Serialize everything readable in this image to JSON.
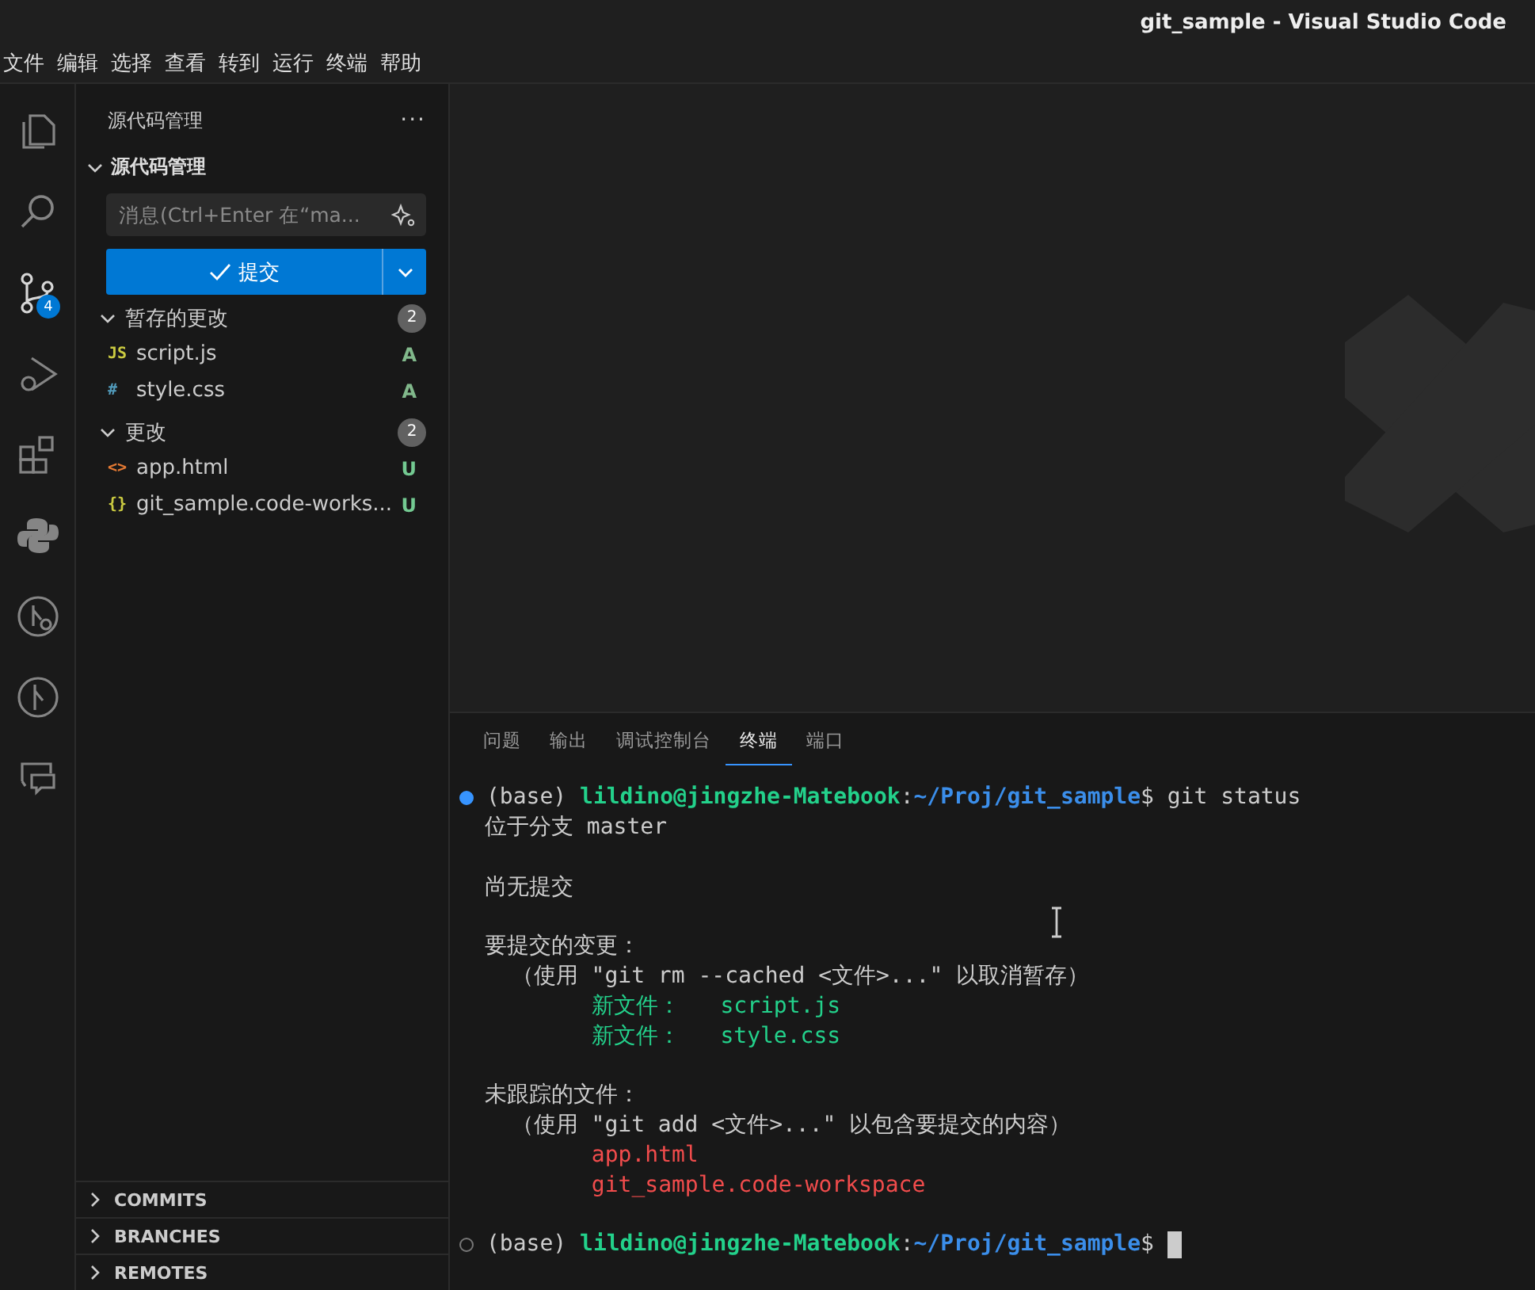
{
  "window": {
    "title": "git_sample - Visual Studio Code"
  },
  "menu": [
    "文件",
    "编辑",
    "选择",
    "查看",
    "转到",
    "运行",
    "终端",
    "帮助"
  ],
  "activity_bar": [
    {
      "kind": "explorer",
      "selected": false
    },
    {
      "kind": "search",
      "selected": false
    },
    {
      "kind": "source_control",
      "selected": true,
      "badge": "4"
    },
    {
      "kind": "run_debug",
      "selected": false
    },
    {
      "kind": "extensions",
      "selected": false
    },
    {
      "kind": "python",
      "selected": false
    },
    {
      "kind": "git_history",
      "selected": false
    },
    {
      "kind": "git_graph",
      "selected": false
    },
    {
      "kind": "remote",
      "selected": false
    }
  ],
  "sidebar": {
    "title": "源代码管理",
    "more": "···",
    "section": {
      "title": "源代码管理",
      "expanded": true
    },
    "message": {
      "placeholder": "消息(Ctrl+Enter 在“ma..."
    },
    "commit_button": {
      "label": "提交"
    },
    "groups": [
      {
        "kind": "staged",
        "title": "暂存的更改",
        "expanded": true,
        "count": "2",
        "files": [
          {
            "icon": "JS",
            "color": "#cbcb41",
            "name": "script.js",
            "status": "A"
          },
          {
            "icon": "#",
            "color": "#519aba",
            "name": "style.css",
            "status": "A"
          }
        ]
      },
      {
        "kind": "changes",
        "title": "更改",
        "expanded": true,
        "count": "2",
        "files": [
          {
            "icon": "<>",
            "color": "#e37933",
            "name": "app.html",
            "status": "U"
          },
          {
            "icon": "{}",
            "color": "#cbcb41",
            "name": "git_sample.code-works...",
            "status": "U"
          }
        ]
      }
    ],
    "bottom_sections": [
      {
        "title": "COMMITS",
        "expanded": false
      },
      {
        "title": "BRANCHES",
        "expanded": false
      },
      {
        "title": "REMOTES",
        "expanded": false
      }
    ]
  },
  "panel": {
    "tabs": [
      {
        "label": "问题",
        "selected": false
      },
      {
        "label": "输出",
        "selected": false
      },
      {
        "label": "调试控制台",
        "selected": false
      },
      {
        "label": "终端",
        "selected": true
      },
      {
        "label": "端口",
        "selected": false
      }
    ],
    "terminal": [
      {
        "kind": "prompt",
        "done": true,
        "env": "(base)",
        "user": "lildino@jingzhe-Matebook",
        "separator": ":",
        "path": "~/Proj/git_sample",
        "sigil": "$",
        "command": "git status"
      },
      {
        "kind": "plain",
        "text": "位于分支 master"
      },
      {
        "kind": "blank"
      },
      {
        "kind": "plain",
        "text": "尚无提交"
      },
      {
        "kind": "blank"
      },
      {
        "kind": "plain",
        "text": "要提交的变更："
      },
      {
        "kind": "plain",
        "text": "  （使用 \"git rm --cached <文件>...\" 以取消暂存）"
      },
      {
        "kind": "staged",
        "text": "        新文件：   script.js"
      },
      {
        "kind": "staged",
        "text": "        新文件：   style.css"
      },
      {
        "kind": "blank"
      },
      {
        "kind": "plain",
        "text": "未跟踪的文件："
      },
      {
        "kind": "plain",
        "text": "  （使用 \"git add <文件>...\" 以包含要提交的内容）"
      },
      {
        "kind": "untracked",
        "text": "        app.html"
      },
      {
        "kind": "untracked",
        "text": "        git_sample.code-workspace"
      },
      {
        "kind": "blank"
      },
      {
        "kind": "prompt",
        "done": false,
        "env": "(base)",
        "user": "lildino@jingzhe-Matebook",
        "separator": ":",
        "path": "~/Proj/git_sample",
        "sigil": "$"
      }
    ]
  }
}
